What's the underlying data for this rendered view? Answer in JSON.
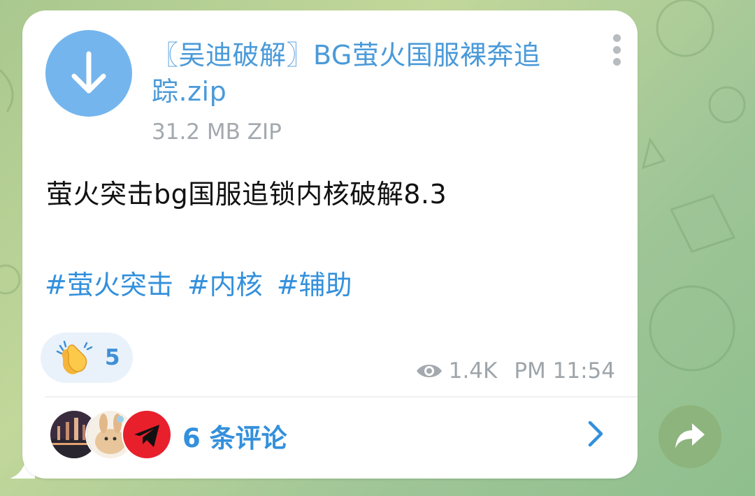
{
  "message": {
    "file_name": "〖吴迪破解〗BG萤火国服裸奔追踪.zip",
    "file_meta": "31.2 MB ZIP",
    "caption": "萤火突击bg国服追锁内核破解8.3",
    "tags": [
      "#萤火突击",
      "#内核",
      "#辅助"
    ],
    "reaction": {
      "emoji_icon": "clapping-hands-icon",
      "count": "5"
    },
    "views": "1.4K",
    "time": "PM 11:54"
  },
  "comments": {
    "label": "6 条评论"
  },
  "colors": {
    "accent": "#3390dc",
    "download_circle": "#74b5ee",
    "share_button": "#8cb47c"
  }
}
